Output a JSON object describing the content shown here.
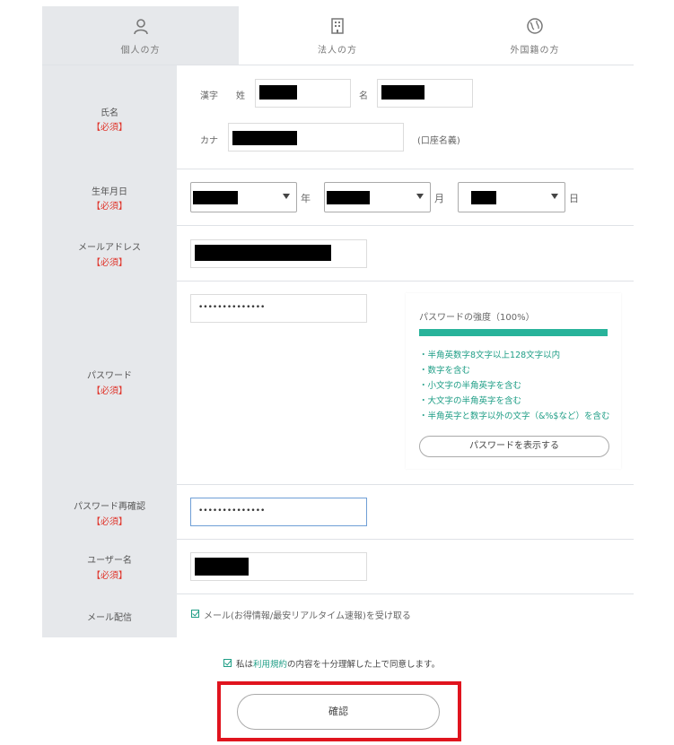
{
  "tabs": [
    {
      "label": "個人の方",
      "icon": "person-icon",
      "active": true
    },
    {
      "label": "法人の方",
      "icon": "building-icon",
      "active": false
    },
    {
      "label": "外国籍の方",
      "icon": "globe-icon",
      "active": false
    }
  ],
  "required": "【必須】",
  "name": {
    "label": "氏名",
    "kanji": "漢字",
    "sei": "姓",
    "mei": "名",
    "kana": "カナ",
    "kana_note": "(口座名義)"
  },
  "birthdate": {
    "label": "生年月日",
    "year": "年",
    "month": "月",
    "day": "日"
  },
  "email": {
    "label": "メールアドレス"
  },
  "password": {
    "label": "パスワード",
    "value": "••••••••••••••",
    "strength_title": "パスワードの強度（100%）",
    "strength_percent": 100,
    "criteria": [
      "・半角英数字8文字以上128文字以内",
      "・数字を含む",
      "・小文字の半角英字を含む",
      "・大文字の半角英字を含む",
      "・半角英字と数字以外の文字（&%$など）を含む"
    ],
    "show_button": "パスワードを表示する"
  },
  "password_confirm": {
    "label": "パスワード再確認",
    "value": "••••••••••••••"
  },
  "username": {
    "label": "ユーザー名"
  },
  "mail_delivery": {
    "label": "メール配信",
    "checkbox_label": "メール(お得情報/最安リアルタイム速報)を受け取る",
    "checked": true
  },
  "terms": {
    "prefix": "私は",
    "link": "利用規約",
    "suffix": "の内容を十分理解した上で同意します。",
    "checked": true
  },
  "confirm_button": "確認",
  "colors": {
    "accent": "#28b39a",
    "required": "#e0352b",
    "highlight": "#e0141e"
  }
}
